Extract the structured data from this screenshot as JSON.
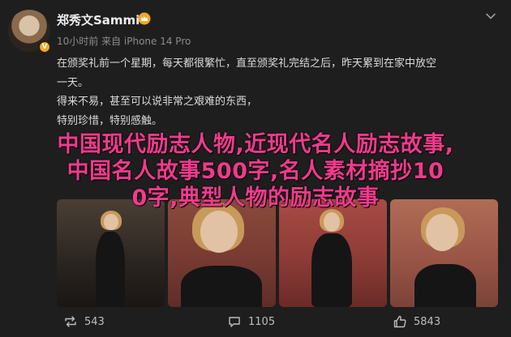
{
  "post": {
    "username": "郑秀文Sammi",
    "meta": "10小时前  来自 iPhone 14 Pro",
    "lines": [
      "在颁奖礼前一个星期，每天都很繁忙，直至颁奖礼完结之后，昨天累到在家中放空",
      "一天。",
      "得来不易，甚至可以说非常之艰难的东西，",
      "特别珍惜，特别感触。"
    ]
  },
  "overlay": {
    "line1": "中国现代励志人物,近现代名人励志故事,",
    "line2": "中国名人故事500字,名人素材摘抄10",
    "line3": "0字,典型人物的励志故事"
  },
  "actions": {
    "reposts": "543",
    "comments": "1105",
    "likes": "5843"
  },
  "icons": {
    "crown": "crown-icon",
    "verified": "verified-badge-icon",
    "more": "chevron-down-icon",
    "repost": "repost-icon",
    "comment": "comment-icon",
    "like": "thumbs-up-icon"
  },
  "colors": {
    "background": "#1e1e1e",
    "overlay_text": "#f23a8d",
    "verified": "#f5a623"
  }
}
